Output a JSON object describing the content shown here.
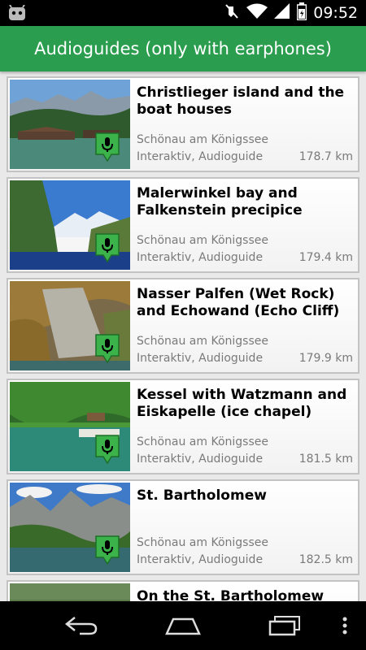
{
  "status_bar": {
    "time": "09:52"
  },
  "app_bar": {
    "title": "Audioguides (only with earphones)"
  },
  "guides": [
    {
      "title": "Christlieger island and the boat houses",
      "location": "Schönau am Königssee",
      "type": "Interaktiv, Audioguide",
      "distance": "178.7 km"
    },
    {
      "title": "Malerwinkel bay and Falkenstein precipice",
      "location": "Schönau am Königssee",
      "type": "Interaktiv, Audioguide",
      "distance": "179.4 km"
    },
    {
      "title": "Nasser Palfen (Wet Rock) and Echowand (Echo Cliff)",
      "location": "Schönau am Königssee",
      "type": "Interaktiv, Audioguide",
      "distance": "179.9 km"
    },
    {
      "title": "Kessel with Watzmann and Eiskapelle (ice chapel)",
      "location": "Schönau am Königssee",
      "type": "Interaktiv, Audioguide",
      "distance": "181.5 km"
    },
    {
      "title": "St. Bartholomew",
      "location": "Schönau am Königssee",
      "type": "Interaktiv, Audioguide",
      "distance": "182.5 km"
    },
    {
      "title": "On the St. Bartholomew",
      "location": "",
      "type": "",
      "distance": ""
    }
  ],
  "colors": {
    "app_bar": "#2a9d4e",
    "marker": "#3cb34a",
    "secondary_text": "#7a7a7a"
  },
  "icons": [
    "android-debug-icon",
    "mute-icon",
    "wifi-icon",
    "signal-icon",
    "battery-icon",
    "audioguide-marker-icon",
    "back-icon",
    "home-icon",
    "recent-apps-icon",
    "overflow-menu-icon"
  ]
}
